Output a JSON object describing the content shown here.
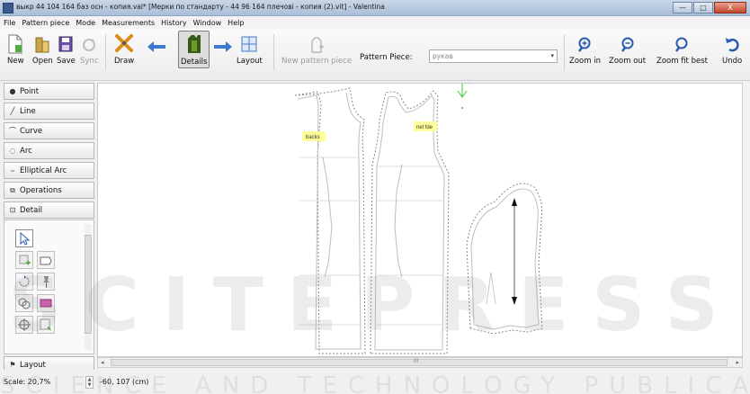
{
  "window": {
    "title": "выкр 44 104 164 баз осн - копия.val* [Мерки по стандарту - 44 96 164 плечові - копия (2).vit] - Valentina",
    "buttons": {
      "minimize": "—",
      "maximize": "□",
      "close": "X"
    }
  },
  "menu": {
    "items": [
      "File",
      "Pattern piece",
      "Mode",
      "Measurements",
      "History",
      "Window",
      "Help"
    ]
  },
  "toolbar": {
    "new": "New",
    "open": "Open",
    "save": "Save",
    "sync": "Sync",
    "draw": "Draw",
    "details": "Details",
    "layout": "Layout",
    "new_pattern_piece": "New pattern piece",
    "pattern_piece_label": "Pattern Piece:",
    "pattern_piece_value": "рукав",
    "zoom_in": "Zoom in",
    "zoom_out": "Zoom out",
    "zoom_fit_best": "Zoom fit best",
    "undo": "Undo"
  },
  "tools": {
    "point": "Point",
    "line": "Line",
    "curve": "Curve",
    "arc": "Arc",
    "elliptical_arc": "Elliptical Arc",
    "operations": "Operations",
    "detail": "Detail",
    "layout": "Layout"
  },
  "canvas": {
    "labels": {
      "back": "backs",
      "front": "nel fde"
    },
    "scroll_marker": "III"
  },
  "status": {
    "scale": "Scale: 20,7%",
    "coords": "-60, 107 (cm)"
  },
  "watermark": {
    "big": "SCITEPRESS",
    "small": "SCIENCE AND TECHNOLOGY PUBLICATIONS"
  },
  "colors": {
    "accent": "#4a7bc4",
    "note_bg": "#ffff99",
    "dashed": "#8a8a8a"
  }
}
